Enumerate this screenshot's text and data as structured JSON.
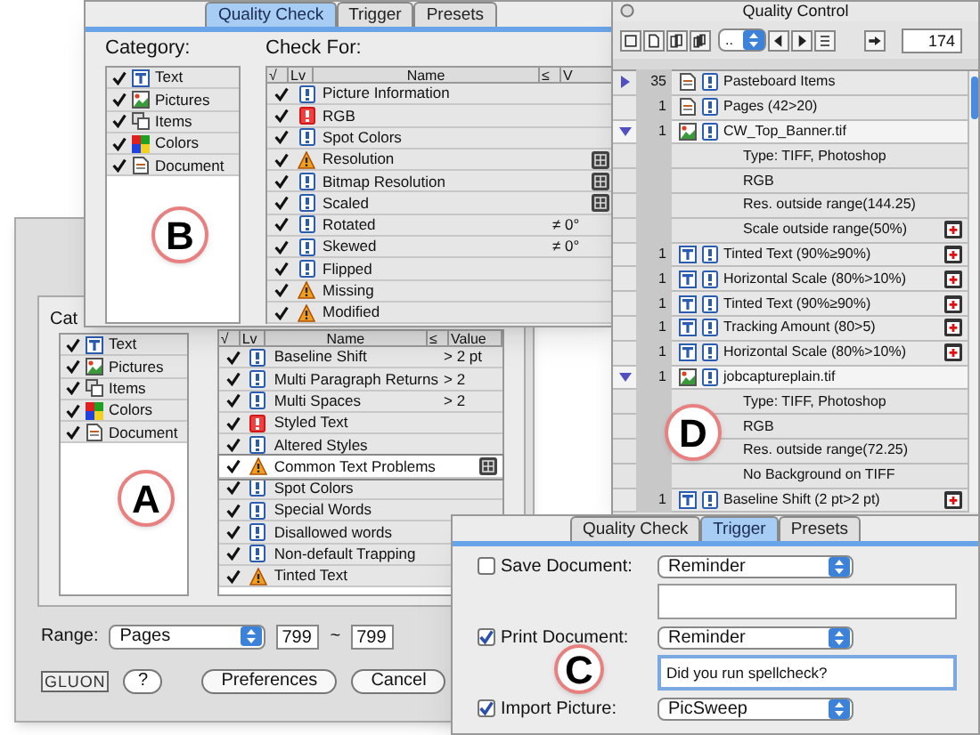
{
  "preferences_window": {
    "category_label": "Cat",
    "categories": [
      {
        "label": "Text",
        "checked": true,
        "kind": "text"
      },
      {
        "label": "Pictures",
        "checked": true,
        "kind": "pictures"
      },
      {
        "label": "Items",
        "checked": true,
        "kind": "items"
      },
      {
        "label": "Colors",
        "checked": true,
        "kind": "colors"
      },
      {
        "label": "Document",
        "checked": true,
        "kind": "document"
      }
    ],
    "columns": [
      "√",
      "Lv",
      "Name",
      "≤",
      "Value"
    ],
    "rows": [
      {
        "name": "Baseline Shift",
        "checked": true,
        "kind": "info",
        "value": "> 2 pt",
        "has_settings": false,
        "selected": false
      },
      {
        "name": "Multi Paragraph Returns",
        "checked": true,
        "kind": "info",
        "value": "> 2",
        "has_settings": false,
        "selected": false
      },
      {
        "name": "Multi Spaces",
        "checked": true,
        "kind": "info",
        "value": "> 2",
        "has_settings": false,
        "selected": false
      },
      {
        "name": "Styled Text",
        "checked": true,
        "kind": "error",
        "has_settings": false,
        "selected": false
      },
      {
        "name": "Altered Styles",
        "checked": true,
        "kind": "info",
        "has_settings": false,
        "selected": false
      },
      {
        "name": "Common Text Problems",
        "checked": true,
        "kind": "warning",
        "has_settings": true,
        "selected": true
      },
      {
        "name": "Spot Colors",
        "checked": true,
        "kind": "info",
        "has_settings": false,
        "selected": false
      },
      {
        "name": "Special Words",
        "checked": true,
        "kind": "info",
        "has_settings": false,
        "selected": false
      },
      {
        "name": "Disallowed words",
        "checked": true,
        "kind": "info",
        "has_settings": false,
        "selected": false
      },
      {
        "name": "Non-default Trapping",
        "checked": true,
        "kind": "info",
        "has_settings": false,
        "selected": false
      },
      {
        "name": "Tinted Text",
        "checked": true,
        "kind": "warning",
        "has_settings": false,
        "selected": false
      }
    ],
    "range_label": "Range:",
    "range_select": "Pages",
    "range_from": "799",
    "range_separator": "~",
    "range_to": "799",
    "logo": "GLUON",
    "help_button": "?",
    "buttons": [
      "Preferences",
      "Cancel"
    ],
    "callout": "A"
  },
  "quality_check_window": {
    "tabs": [
      {
        "label": "Quality Check",
        "selected": true
      },
      {
        "label": "Trigger",
        "selected": false
      },
      {
        "label": "Presets",
        "selected": false
      }
    ],
    "category_label": "Category:",
    "categories": [
      {
        "label": "Text",
        "checked": true,
        "kind": "text"
      },
      {
        "label": "Pictures",
        "checked": true,
        "kind": "pictures"
      },
      {
        "label": "Items",
        "checked": true,
        "kind": "items"
      },
      {
        "label": "Colors",
        "checked": true,
        "kind": "colors"
      },
      {
        "label": "Document",
        "checked": true,
        "kind": "document"
      }
    ],
    "check_label": "Check For:",
    "columns": [
      "√",
      "Lv",
      "Name",
      "≤",
      "V"
    ],
    "rows": [
      {
        "name": "Picture Information",
        "checked": true,
        "kind": "info",
        "has_settings": false
      },
      {
        "name": "RGB",
        "checked": true,
        "kind": "error",
        "has_settings": false
      },
      {
        "name": "Spot Colors",
        "checked": true,
        "kind": "info",
        "has_settings": false
      },
      {
        "name": "Resolution",
        "checked": true,
        "kind": "warning",
        "has_settings": true
      },
      {
        "name": "Bitmap Resolution",
        "checked": true,
        "kind": "info",
        "has_settings": true
      },
      {
        "name": "Scaled",
        "checked": true,
        "kind": "info",
        "has_settings": true
      },
      {
        "name": "Rotated",
        "checked": true,
        "kind": "info",
        "value": "≠ 0°",
        "has_settings": false
      },
      {
        "name": "Skewed",
        "checked": true,
        "kind": "info",
        "value": "≠ 0°",
        "has_settings": false
      },
      {
        "name": "Flipped",
        "checked": true,
        "kind": "info",
        "has_settings": false
      },
      {
        "name": "Missing",
        "checked": true,
        "kind": "warning",
        "has_settings": false
      },
      {
        "name": "Modified",
        "checked": true,
        "kind": "warning",
        "has_settings": false
      }
    ],
    "callout": "B"
  },
  "quality_control_window": {
    "title": "Quality Control",
    "page_select": "..",
    "count_field": "174",
    "rows": [
      {
        "kind": "group",
        "expanded": false,
        "count": "35",
        "object": {
          "kind": "document"
        },
        "name": "Pasteboard Items",
        "flagged": false
      },
      {
        "kind": "item",
        "count": "1",
        "object": {
          "kind": "document"
        },
        "name": "Pages (42>20)",
        "flagged": false
      },
      {
        "kind": "group",
        "expanded": true,
        "count": "1",
        "object": {
          "kind": "picture"
        },
        "name": "CW_Top_Banner.tif",
        "flagged": false
      },
      {
        "kind": "detail",
        "name": "Type: TIFF, Photoshop",
        "flagged": false
      },
      {
        "kind": "detail",
        "name": "RGB",
        "flagged": false
      },
      {
        "kind": "detail",
        "name": "Res. outside range(144.25)",
        "flagged": false
      },
      {
        "kind": "detail",
        "name": "Scale outside range(50%)",
        "flagged": true
      },
      {
        "kind": "item",
        "count": "1",
        "object": {
          "kind": "text"
        },
        "name": "Tinted Text (90%≥90%)",
        "flagged": true
      },
      {
        "kind": "item",
        "count": "1",
        "object": {
          "kind": "text"
        },
        "name": "Horizontal Scale (80%>10%)",
        "flagged": true
      },
      {
        "kind": "item",
        "count": "1",
        "object": {
          "kind": "text"
        },
        "name": "Tinted Text (90%≥90%)",
        "flagged": true
      },
      {
        "kind": "item",
        "count": "1",
        "object": {
          "kind": "text"
        },
        "name": "Tracking Amount (80>5)",
        "flagged": true
      },
      {
        "kind": "item",
        "count": "1",
        "object": {
          "kind": "text"
        },
        "name": "Horizontal Scale (80%>10%)",
        "flagged": true
      },
      {
        "kind": "group",
        "expanded": true,
        "count": "1",
        "object": {
          "kind": "picture"
        },
        "name": "jobcaptureplain.tif",
        "flagged": false
      },
      {
        "kind": "detail",
        "name": "Type: TIFF, Photoshop",
        "flagged": false
      },
      {
        "kind": "detail",
        "name": "RGB",
        "flagged": false
      },
      {
        "kind": "detail",
        "name": "Res. outside range(72.25)",
        "flagged": false
      },
      {
        "kind": "detail",
        "name": "No Background on TIFF",
        "flagged": false
      },
      {
        "kind": "item",
        "count": "1",
        "object": {
          "kind": "text"
        },
        "name": "Baseline Shift (2 pt>2 pt)",
        "flagged": true
      }
    ],
    "callout": "D"
  },
  "trigger_window": {
    "tabs": [
      {
        "label": "Quality Check",
        "selected": false
      },
      {
        "label": "Trigger",
        "selected": true
      },
      {
        "label": "Presets",
        "selected": false
      }
    ],
    "triggers": [
      {
        "label": "Save Document:",
        "checked": false,
        "action": "Reminder",
        "has_message": true
      },
      {
        "label": "Print Document:",
        "checked": true,
        "action": "Reminder",
        "has_message": true,
        "message": "Did you run spellcheck?"
      },
      {
        "label": "Import Picture:",
        "checked": true,
        "action": "PicSweep",
        "has_message": false
      }
    ],
    "callout": "C"
  }
}
